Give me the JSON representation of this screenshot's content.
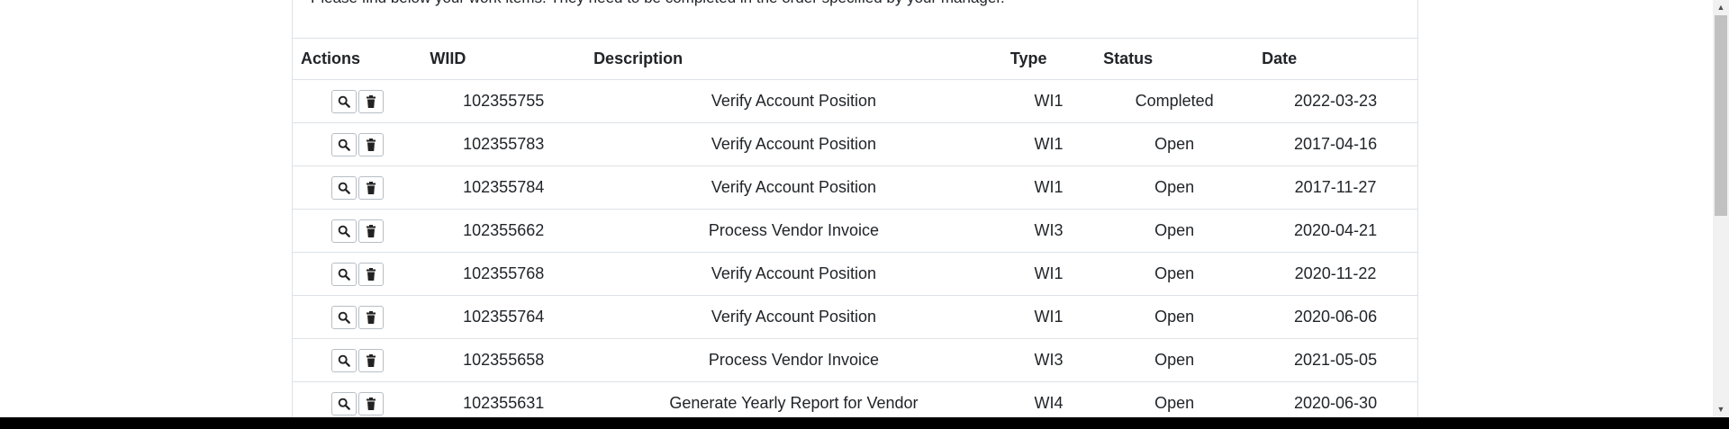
{
  "intro_text": "Please find below your work items. They need to be completed in the order specified by your manager.",
  "table": {
    "headers": {
      "actions": "Actions",
      "wiid": "WIID",
      "description": "Description",
      "type": "Type",
      "status": "Status",
      "date": "Date"
    },
    "rows": [
      {
        "wiid": "102355755",
        "description": "Verify Account Position",
        "type": "WI1",
        "status": "Completed",
        "date": "2022-03-23"
      },
      {
        "wiid": "102355783",
        "description": "Verify Account Position",
        "type": "WI1",
        "status": "Open",
        "date": "2017-04-16"
      },
      {
        "wiid": "102355784",
        "description": "Verify Account Position",
        "type": "WI1",
        "status": "Open",
        "date": "2017-11-27"
      },
      {
        "wiid": "102355662",
        "description": "Process Vendor Invoice",
        "type": "WI3",
        "status": "Open",
        "date": "2020-04-21"
      },
      {
        "wiid": "102355768",
        "description": "Verify Account Position",
        "type": "WI1",
        "status": "Open",
        "date": "2020-11-22"
      },
      {
        "wiid": "102355764",
        "description": "Verify Account Position",
        "type": "WI1",
        "status": "Open",
        "date": "2020-06-06"
      },
      {
        "wiid": "102355658",
        "description": "Process Vendor Invoice",
        "type": "WI3",
        "status": "Open",
        "date": "2021-05-05"
      },
      {
        "wiid": "102355631",
        "description": "Generate Yearly Report for Vendor",
        "type": "WI4",
        "status": "Open",
        "date": "2020-06-30"
      }
    ]
  },
  "icons": {
    "view": "search-icon",
    "delete": "trash-icon"
  },
  "scrollbar": {
    "up_arrow": "▲",
    "down_arrow": "▼"
  }
}
